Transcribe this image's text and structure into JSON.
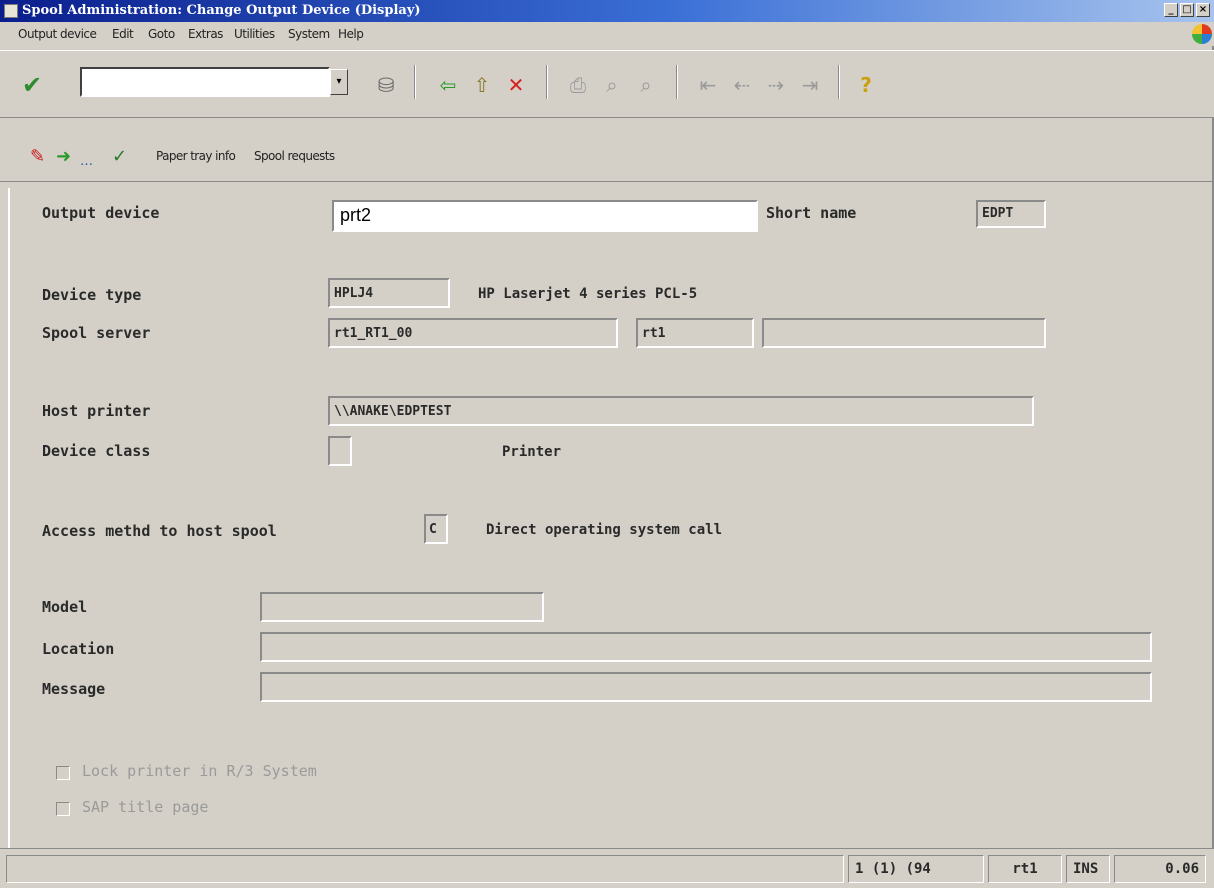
{
  "window": {
    "title": "Spool Administration: Change Output Device (Display)",
    "controls": [
      "_",
      "□",
      "×"
    ]
  },
  "menu": [
    "Output device",
    "Edit",
    "Goto",
    "Extras",
    "Utilities",
    "System",
    "Help"
  ],
  "toolbar": {
    "command_field_value": "",
    "icons": [
      "enter-icon",
      "save-icon",
      "back-icon",
      "exit-icon",
      "cancel-icon",
      "print-icon",
      "find-icon",
      "find-next-icon",
      "first-page-icon",
      "previous-page-icon",
      "next-page-icon",
      "last-page-icon",
      "help-icon"
    ]
  },
  "app_toolbar": {
    "links": [
      "Paper tray info",
      "Spool requests"
    ]
  },
  "form": {
    "output_device": {
      "label": "Output device",
      "value": "prt2"
    },
    "short_name": {
      "label": "Short name",
      "value": "EDPT"
    },
    "device_type": {
      "label": "Device type",
      "value": "HPLJ4",
      "description": "HP Laserjet 4 series PCL-5"
    },
    "spool_server": {
      "label": "Spool server",
      "value": "rt1_RT1_00",
      "value2": "rt1",
      "value3": ""
    },
    "host_printer": {
      "label": "Host printer",
      "value": "\\\\ANAKE\\EDPTEST"
    },
    "device_class": {
      "label": "Device class",
      "value": "",
      "description": "Printer"
    },
    "access_method": {
      "label": "Access methd to host spool",
      "value": "C",
      "description": "Direct operating system call"
    },
    "model": {
      "label": "Model",
      "value": ""
    },
    "location": {
      "label": "Location",
      "value": ""
    },
    "message": {
      "label": "Message",
      "value": ""
    },
    "lock_printer": {
      "label": "Lock printer in R/3 System",
      "checked": false
    },
    "sap_title_page": {
      "label": "SAP title page",
      "checked": false
    }
  },
  "status": {
    "message": "",
    "session": "1 (1) (94",
    "server": "rt1",
    "mode": "INS",
    "time": "0.06"
  }
}
